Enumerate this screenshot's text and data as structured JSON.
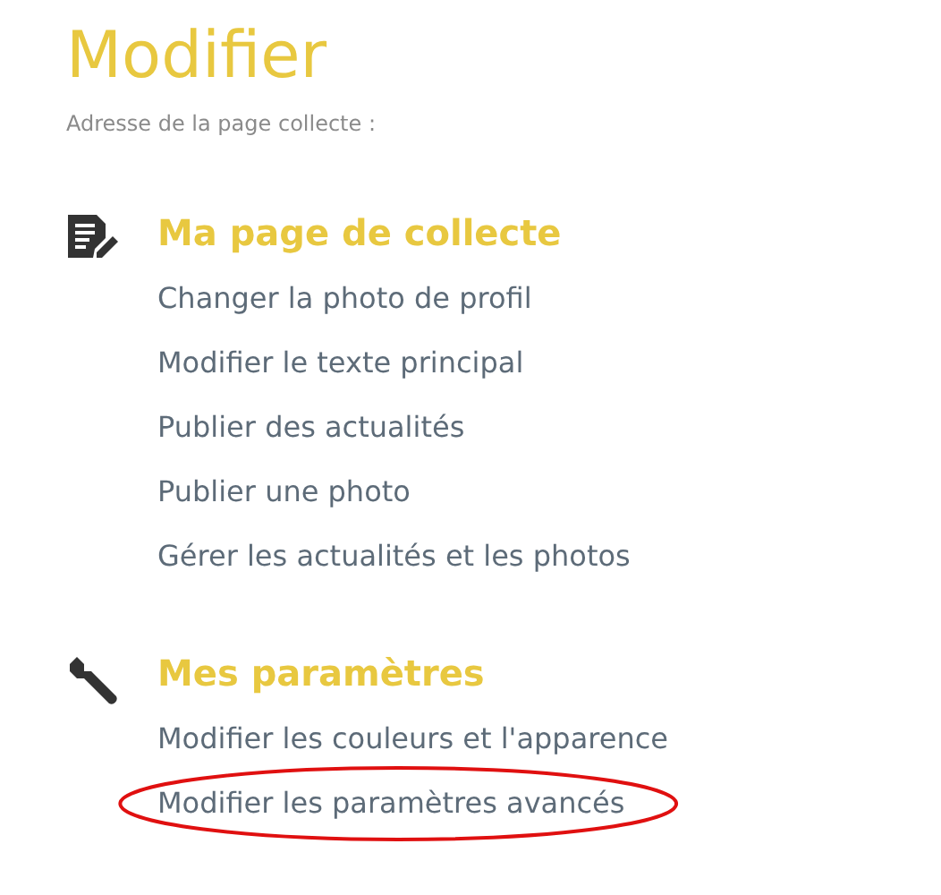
{
  "title": "Modifier",
  "subtitle": "Adresse de la page collecte :",
  "sections": [
    {
      "kind": "page",
      "heading": "Ma page de collecte",
      "links": [
        {
          "label": "Changer la photo de profil",
          "highlighted": false
        },
        {
          "label": "Modifier le texte principal",
          "highlighted": false
        },
        {
          "label": "Publier des actualités",
          "highlighted": false
        },
        {
          "label": "Publier une photo",
          "highlighted": false
        },
        {
          "label": "Gérer les actualités et les photos",
          "highlighted": false
        }
      ]
    },
    {
      "kind": "settings",
      "heading": "Mes paramètres",
      "links": [
        {
          "label": "Modifier les couleurs et l'apparence",
          "highlighted": false
        },
        {
          "label": "Modifier les paramètres avancés",
          "highlighted": true
        }
      ]
    }
  ]
}
